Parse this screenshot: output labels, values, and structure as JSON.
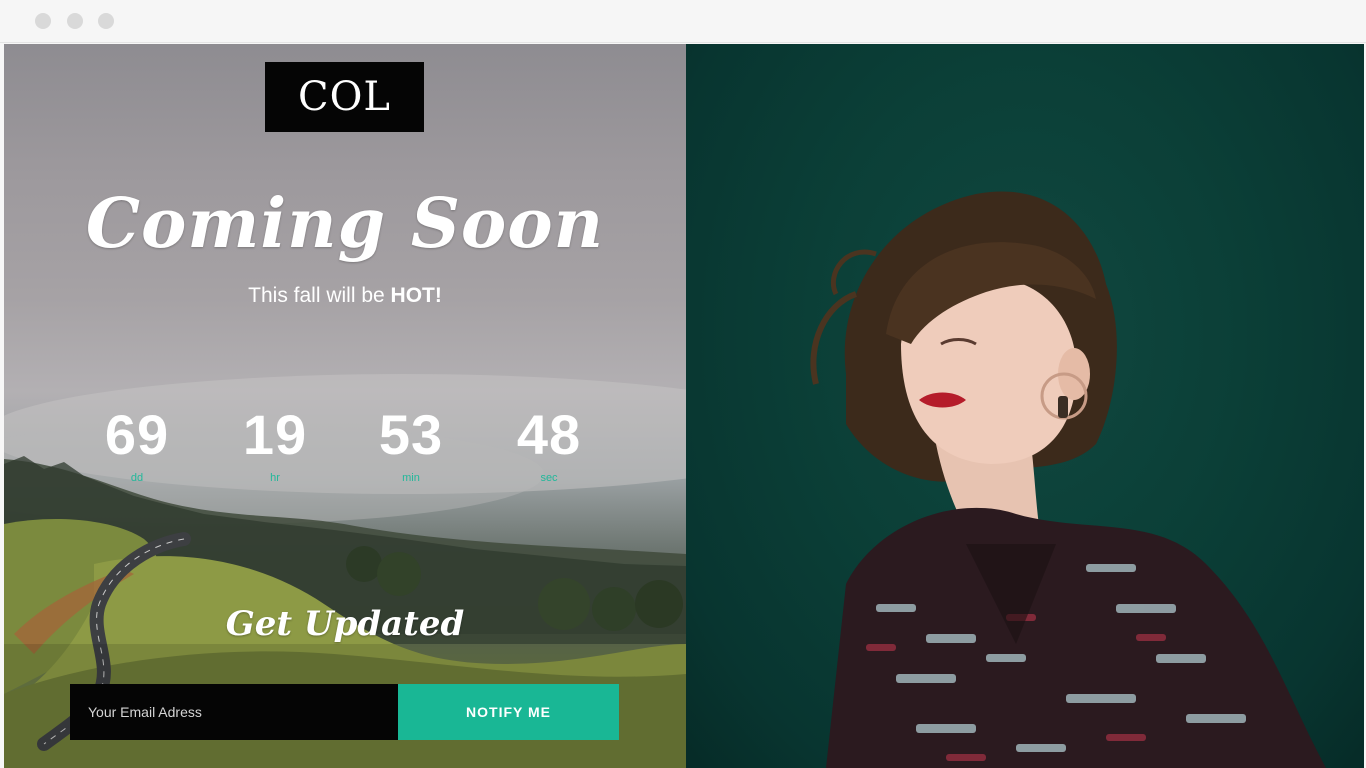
{
  "logo": {
    "text": "COL"
  },
  "hero": {
    "title": "Coming Soon",
    "tagline_prefix": "This fall will be ",
    "tagline_highlight": "HOT!"
  },
  "countdown": [
    {
      "value": "69",
      "label": "dd"
    },
    {
      "value": "19",
      "label": "hr"
    },
    {
      "value": "53",
      "label": "min"
    },
    {
      "value": "48",
      "label": "sec"
    }
  ],
  "signup": {
    "heading": "Get Updated",
    "email_placeholder": "Your Email Adress",
    "button_label": "NOTIFY ME"
  },
  "colors": {
    "accent": "#19b795",
    "right_background": "#0b3f37",
    "input_background": "#050505"
  }
}
